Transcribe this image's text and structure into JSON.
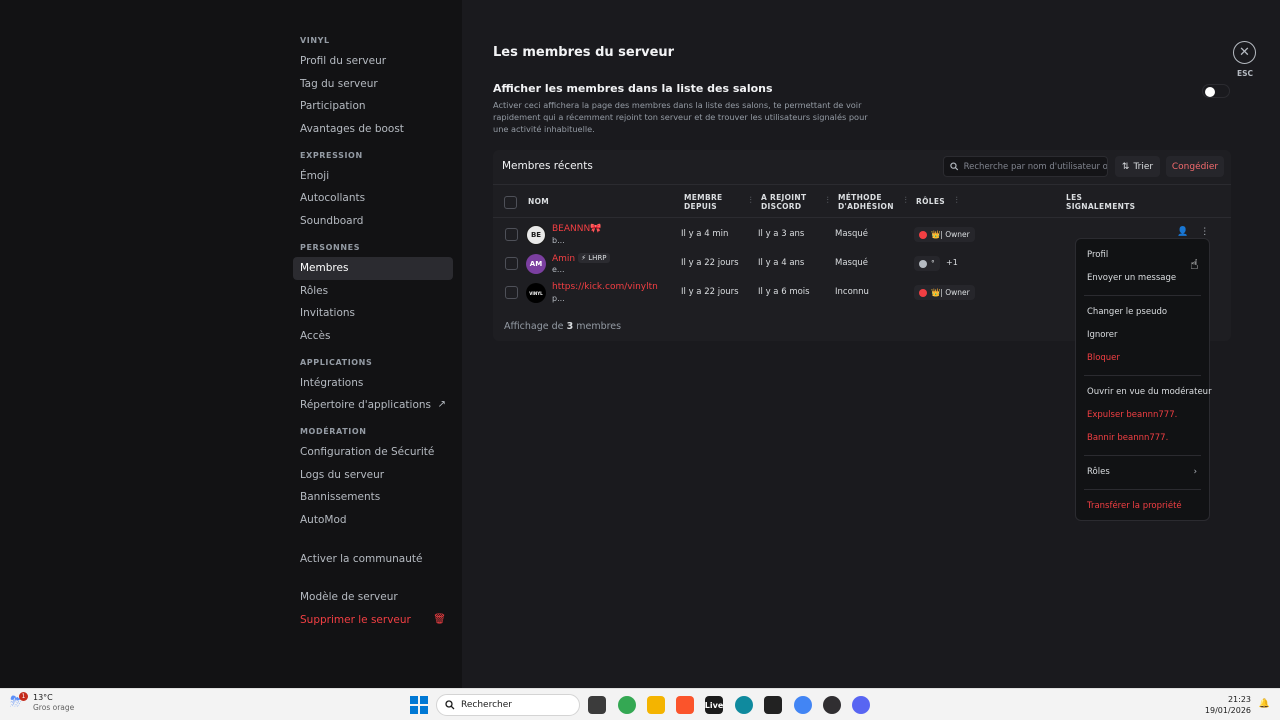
{
  "window": {
    "minimize": "—",
    "maximize": "☐",
    "close": "✕"
  },
  "sidebar": {
    "sections": [
      {
        "title": "VINYL",
        "items": [
          {
            "label": "Profil du serveur"
          },
          {
            "label": "Tag du serveur"
          },
          {
            "label": "Participation"
          },
          {
            "label": "Avantages de boost"
          }
        ]
      },
      {
        "title": "EXPRESSION",
        "items": [
          {
            "label": "Émoji"
          },
          {
            "label": "Autocollants"
          },
          {
            "label": "Soundboard"
          }
        ]
      },
      {
        "title": "PERSONNES",
        "items": [
          {
            "label": "Membres"
          },
          {
            "label": "Rôles"
          },
          {
            "label": "Invitations"
          },
          {
            "label": "Accès"
          }
        ]
      },
      {
        "title": "APPLICATIONS",
        "items": [
          {
            "label": "Intégrations"
          },
          {
            "label": "Répertoire d'applications"
          }
        ]
      },
      {
        "title": "MODÉRATION",
        "items": [
          {
            "label": "Configuration de Sécurité"
          },
          {
            "label": "Logs du serveur"
          },
          {
            "label": "Bannissements"
          },
          {
            "label": "AutoMod"
          }
        ]
      }
    ],
    "community": "Activer la communauté",
    "template": "Modèle de serveur",
    "delete": "Supprimer le serveur"
  },
  "main": {
    "title": "Les membres du serveur",
    "toggle_title": "Afficher les membres dans la liste des salons",
    "toggle_desc": "Activer ceci affichera la page des membres dans la liste des salons, te permettant de voir rapidement qui a récemment rejoint ton serveur et de trouver les utilisateurs signalés pour une activité inhabituelle.",
    "toggle_on": false,
    "close_label": "ESC"
  },
  "members": {
    "title": "Membres récents",
    "search_placeholder": "Recherche par nom d'utilisateur ou",
    "sort_label": "Trier",
    "kick_label": "Congédier",
    "columns": {
      "name": "NOM",
      "since1": "MEMBRE",
      "since2": "DEPUIS",
      "joined1": "A REJOINT",
      "joined2": "DISCORD",
      "method1": "MÉTHODE",
      "method2": "D'ADHÉSION",
      "roles": "RÔLES",
      "reports1": "LES",
      "reports2": "SIGNALEMENTS"
    },
    "rows": [
      {
        "name": "BEANNN",
        "name_suffix": "🎀",
        "sub": "b...",
        "tag": "",
        "since": "Il y a 4 min",
        "joined": "Il y a 3 ans",
        "method": "Masqué",
        "role": "👑| Owner",
        "role_color": "#f23f43",
        "extra": "",
        "avatar": "BE",
        "avatar_bg": "#e8e8e8"
      },
      {
        "name": "Amin",
        "name_suffix": "",
        "sub": "e...",
        "tag": "⚡ LHRP",
        "since": "Il y a 22 jours",
        "joined": "Il y a 4 ans",
        "method": "Masqué",
        "role": "°",
        "role_color": "#b5bac1",
        "extra": "+1",
        "avatar": "AM",
        "avatar_bg": "#7b3fa0"
      },
      {
        "name": "https://kick.com/vinyltn",
        "name_suffix": "",
        "sub": "p...",
        "tag": "",
        "since": "Il y a 22 jours",
        "joined": "Il y a 6 mois",
        "method": "Inconnu",
        "role": "👑| Owner",
        "role_color": "#f23f43",
        "extra": "",
        "avatar": "VINYL",
        "avatar_bg": "#000000"
      }
    ],
    "footer_prefix": "Affichage de",
    "footer_count": "3",
    "footer_suffix": "membres"
  },
  "context_menu": {
    "groups": [
      [
        {
          "label": "Profil",
          "danger": false
        },
        {
          "label": "Envoyer un message",
          "danger": false
        }
      ],
      [
        {
          "label": "Changer le pseudo",
          "danger": false
        },
        {
          "label": "Ignorer",
          "danger": false
        },
        {
          "label": "Bloquer",
          "danger": true
        }
      ],
      [
        {
          "label": "Ouvrir en vue du modérateur",
          "danger": false
        },
        {
          "label": "Expulser beannn777.",
          "danger": true
        },
        {
          "label": "Bannir beannn777.",
          "danger": true
        }
      ],
      [
        {
          "label": "Rôles",
          "danger": false,
          "submenu": true
        }
      ],
      [
        {
          "label": "Transférer la propriété",
          "danger": true
        }
      ]
    ]
  },
  "taskbar": {
    "temp": "13°C",
    "weather": "Gros orage",
    "weather_badge": "1",
    "search": "Rechercher",
    "time": "21:23",
    "date": "19/01/2026",
    "apps": [
      {
        "name": "task-view",
        "label": "",
        "color": "#3b3b3b"
      },
      {
        "name": "chrome",
        "label": "",
        "color": "#34a853"
      },
      {
        "name": "file-explorer",
        "label": "",
        "color": "#f4b400"
      },
      {
        "name": "brave",
        "label": "",
        "color": "#fb542b"
      },
      {
        "name": "live",
        "label": "Live",
        "color": "#1b1b1b"
      },
      {
        "name": "edge",
        "label": "",
        "color": "#0f8a9e"
      },
      {
        "name": "capcut",
        "label": "",
        "color": "#222222"
      },
      {
        "name": "chrome-2",
        "label": "",
        "color": "#4285f4"
      },
      {
        "name": "obs",
        "label": "",
        "color": "#302e31"
      },
      {
        "name": "discord",
        "label": "",
        "color": "#5865f2"
      }
    ]
  }
}
